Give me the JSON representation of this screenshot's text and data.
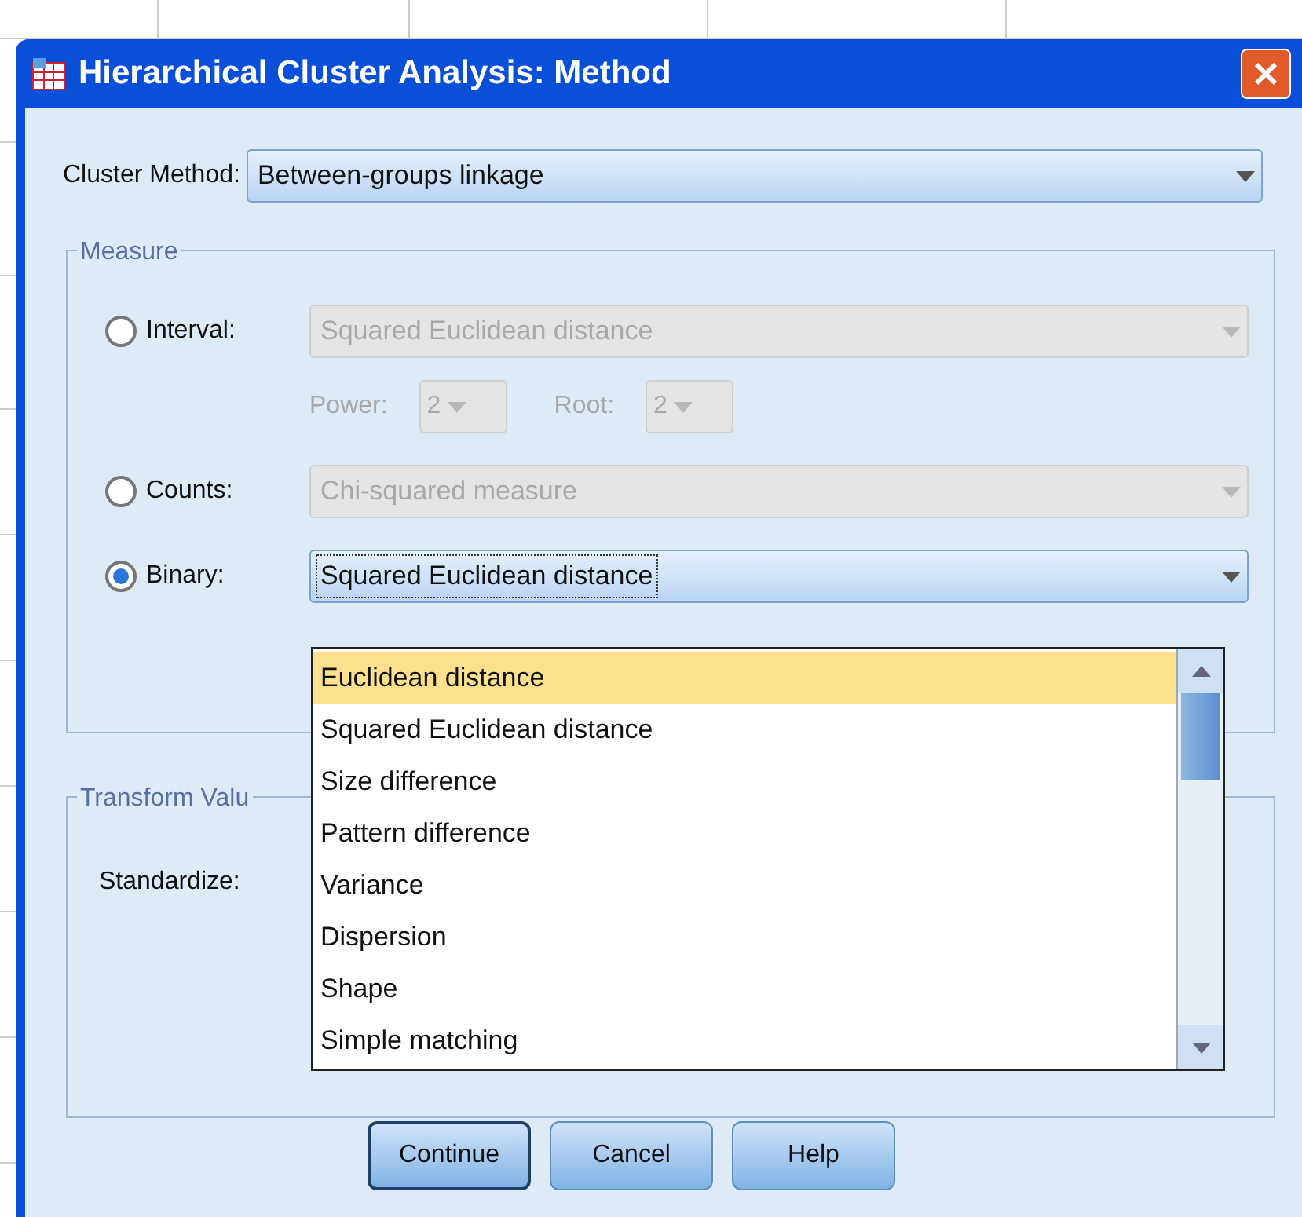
{
  "window": {
    "title": "Hierarchical Cluster Analysis: Method"
  },
  "cluster_method": {
    "label": "Cluster Method:",
    "value": "Between-groups linkage"
  },
  "measure": {
    "title": "Measure",
    "options": [
      {
        "label": "Interval:",
        "selected": false,
        "value": "Squared Euclidean distance",
        "disabled": true,
        "focused": false
      },
      {
        "label": "Counts:",
        "selected": false,
        "value": "Chi-squared measure",
        "disabled": true,
        "focused": false
      },
      {
        "label": "Binary:",
        "selected": true,
        "value": "Squared Euclidean distance",
        "disabled": false,
        "focused": true
      }
    ],
    "sub_fields": [
      {
        "label": "Power:",
        "value": "2",
        "disabled": true
      },
      {
        "label": "Root:",
        "value": "2",
        "disabled": true
      }
    ]
  },
  "binary_list": {
    "expanded": true,
    "items": [
      {
        "label": "Euclidean distance",
        "selected": true
      },
      {
        "label": "Squared Euclidean distance",
        "selected": false
      },
      {
        "label": "Size difference",
        "selected": false
      },
      {
        "label": "Pattern difference",
        "selected": false
      },
      {
        "label": "Variance",
        "selected": false
      },
      {
        "label": "Dispersion",
        "selected": false
      },
      {
        "label": "Shape",
        "selected": false
      },
      {
        "label": "Simple matching",
        "selected": false
      }
    ]
  },
  "transform_values": {
    "title": "Transform Valu",
    "standardize_label": "Standardize:"
  },
  "buttons": [
    {
      "label": "Continue",
      "default": true
    },
    {
      "label": "Cancel",
      "default": false
    },
    {
      "label": "Help",
      "default": false
    }
  ]
}
